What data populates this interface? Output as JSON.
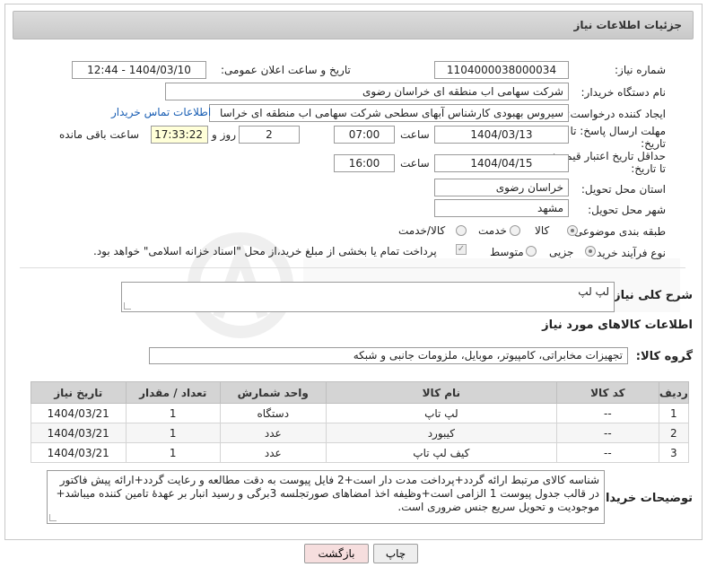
{
  "header": {
    "title": "جزئیات اطلاعات نیاز"
  },
  "fields": {
    "need_number_label": "شماره نیاز:",
    "need_number": "1104000038000034",
    "announce_label": "تاریخ و ساعت اعلان عمومی:",
    "announce_value": "1404/03/10 - 12:44",
    "buyer_org_label": "نام دستگاه خریدار:",
    "buyer_org": "شرکت سهامی اب منطقه ای خراسان رضوی",
    "creator_label": "ایجاد کننده درخواست:",
    "creator": "سیروس  بهبودی کارشناس آبهای سطحی شرکت سهامی اب منطقه ای خراسا",
    "contact_link": "اطلاعات تماس خریدار",
    "deadline_label_1": "مهلت ارسال پاسخ: تا",
    "deadline_label_2": "تاریخ:",
    "deadline_date": "1404/03/13",
    "time_label": "ساعت",
    "deadline_time": "07:00",
    "days_value": "2",
    "days_label": "روز و",
    "remaining_time": "17:33:22",
    "remaining_label": "ساعت باقی مانده",
    "validity_label_1": "حداقل تاریخ اعتبار قیمت:",
    "validity_label_2": "تا تاریخ:",
    "validity_date": "1404/04/15",
    "validity_time": "16:00",
    "province_label": "استان محل تحویل:",
    "province": "خراسان رضوی",
    "city_label": "شهر محل تحویل:",
    "city": "مشهد",
    "category_label": "طبقه بندی موضوعی:",
    "category_options": [
      "کالا",
      "خدمت",
      "کالا/خدمت"
    ],
    "process_label": "نوع فرآیند خرید :",
    "process_options": [
      "جزیی",
      "متوسط"
    ],
    "payment_note": "پرداخت تمام یا بخشی از مبلغ خرید،از محل \"اسناد خزانه اسلامی\" خواهد بود."
  },
  "summary": {
    "label": "شرح کلی نیاز:",
    "value": "لپ لپ"
  },
  "goods": {
    "section_title": "اطلاعات کالاهای مورد نیاز",
    "group_label": "گروه کالا:",
    "group_value": "تجهیزات مخابراتی، کامپیوتر، موبایل، ملزومات جانبی و شبکه",
    "columns": [
      "ردیف",
      "کد کالا",
      "نام کالا",
      "واحد شمارش",
      "تعداد / مقدار",
      "تاریخ نیاز"
    ],
    "rows": [
      [
        "1",
        "--",
        "لپ تاپ",
        "دستگاه",
        "1",
        "1404/03/21"
      ],
      [
        "2",
        "--",
        "کیبورد",
        "عدد",
        "1",
        "1404/03/21"
      ],
      [
        "3",
        "--",
        "کیف لپ تاپ",
        "عدد",
        "1",
        "1404/03/21"
      ]
    ]
  },
  "notes": {
    "label": "توضیحات خریدار:",
    "value": "شناسه کالای مرتبط ارائه گردد+پرداخت مدت دار است+2 فایل پیوست به دقت مطالعه و رعایت گردد+ارائه پیش فاکتور در قالب جدول پیوست 1 الزامی است+وظیفه اخذ امضاهای صورتجلسه 3برگی و رسید انبار بر عهدهٔ تامین کننده میباشد+ موجودیت و تحویل سریع جنس ضروری است."
  },
  "buttons": {
    "print": "چاپ",
    "back": "بازگشت"
  },
  "colors": {
    "back_button_bg": "#f6dede",
    "print_button_bg": "#eeeeee",
    "link": "#1a5fb4"
  }
}
